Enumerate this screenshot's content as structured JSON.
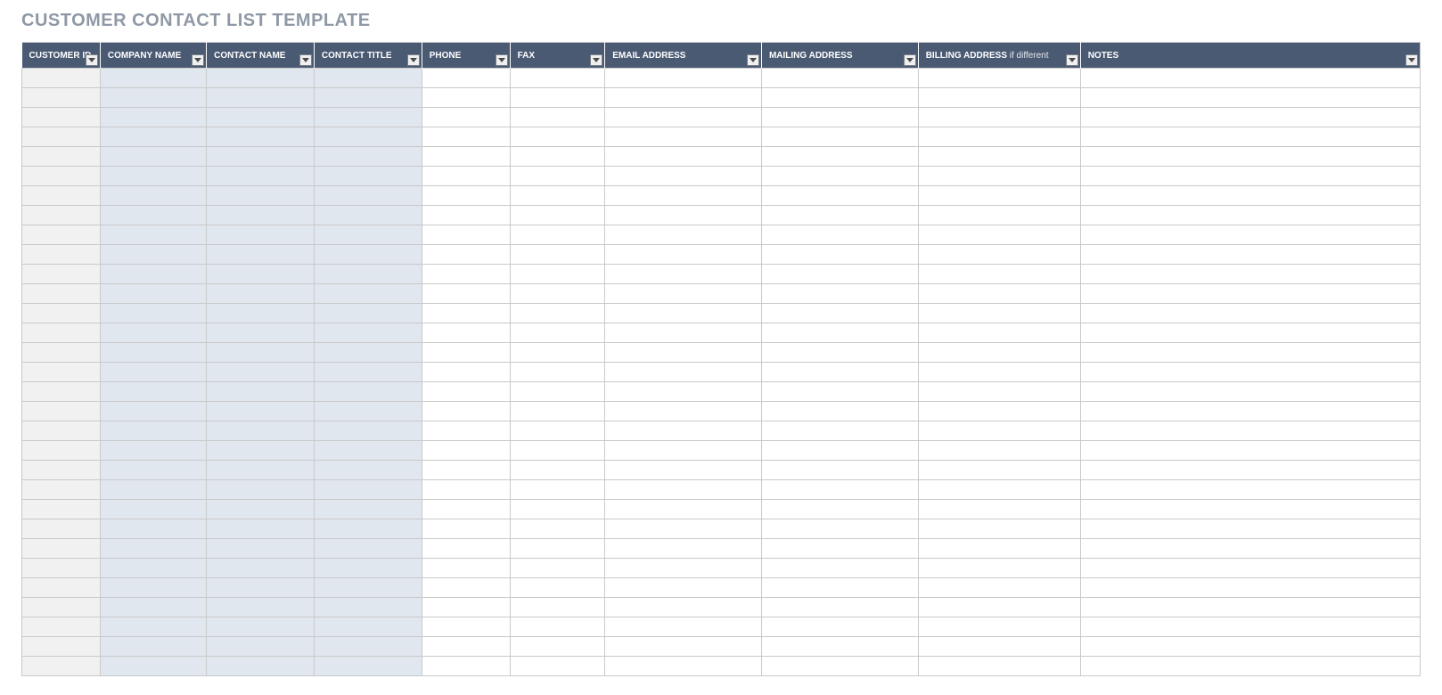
{
  "title": "CUSTOMER CONTACT LIST TEMPLATE",
  "columns": [
    {
      "label": "CUSTOMER ID",
      "suffix": ""
    },
    {
      "label": "COMPANY NAME",
      "suffix": ""
    },
    {
      "label": "CONTACT NAME",
      "suffix": ""
    },
    {
      "label": "CONTACT TITLE",
      "suffix": ""
    },
    {
      "label": "PHONE",
      "suffix": ""
    },
    {
      "label": "FAX",
      "suffix": ""
    },
    {
      "label": "EMAIL ADDRESS",
      "suffix": ""
    },
    {
      "label": "MAILING ADDRESS",
      "suffix": ""
    },
    {
      "label": "BILLING ADDRESS",
      "suffix": " if different"
    },
    {
      "label": "NOTES",
      "suffix": ""
    }
  ],
  "row_count": 31,
  "rows": []
}
